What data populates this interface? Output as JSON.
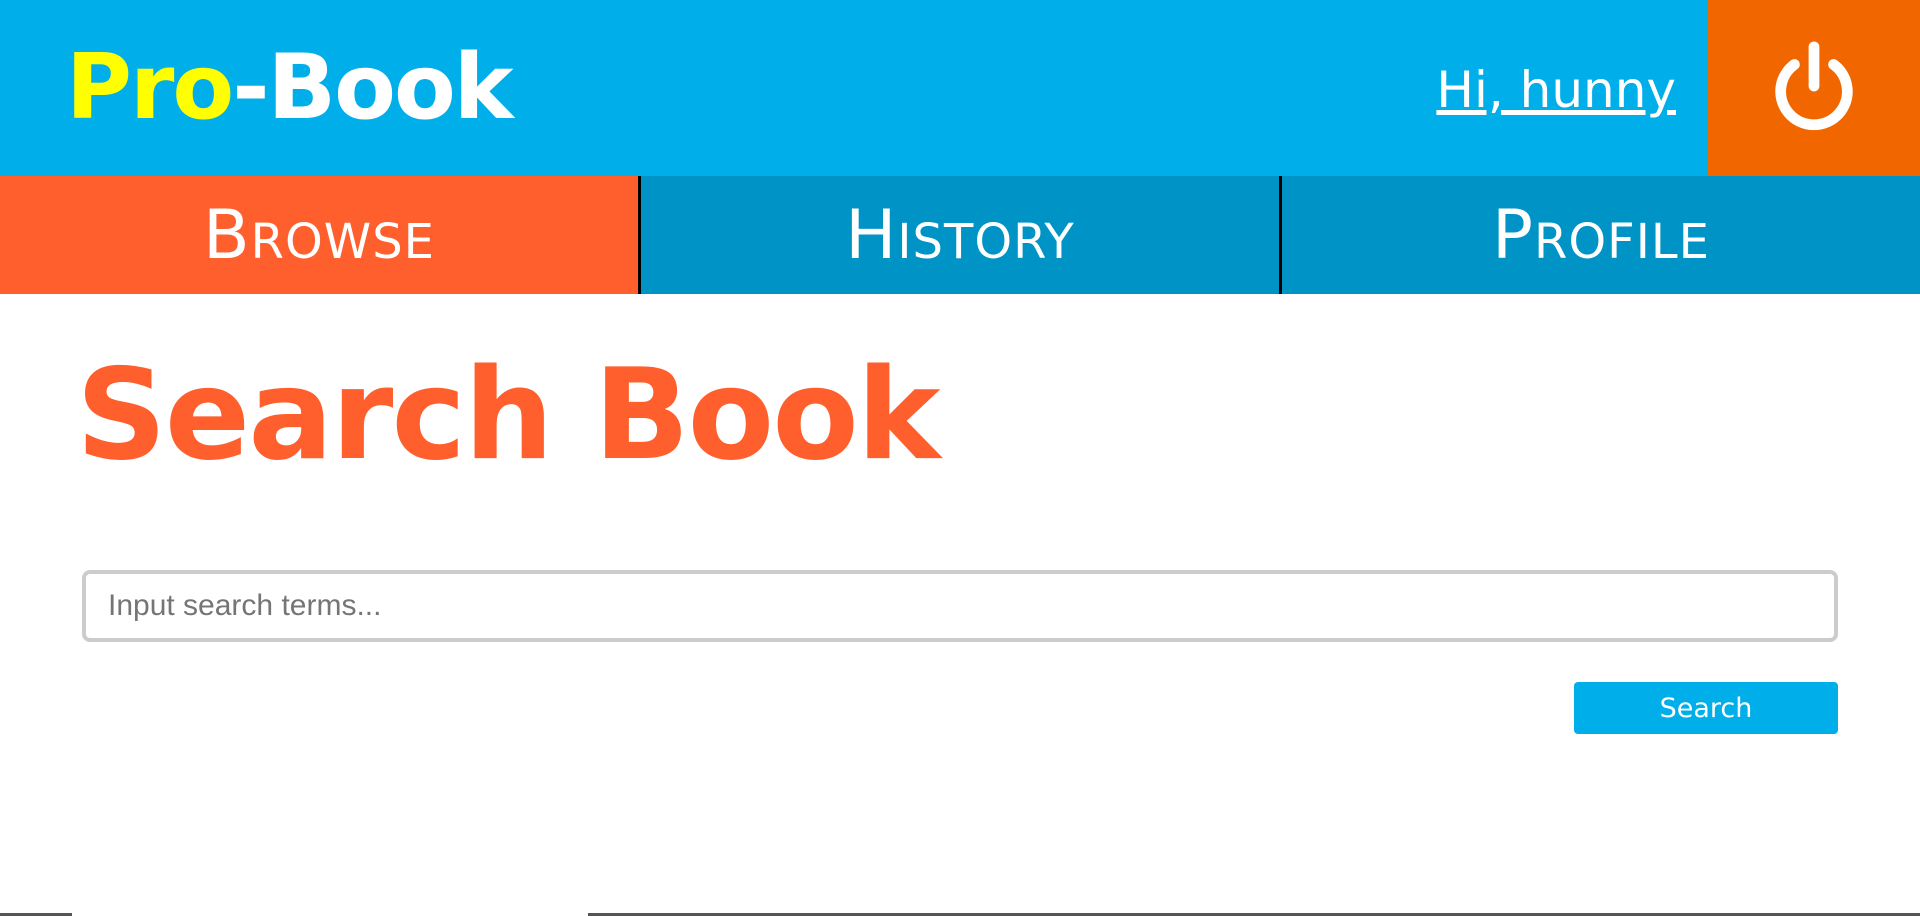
{
  "header": {
    "logo_pro": "Pro",
    "logo_rest": "-Book",
    "greeting": "Hi, hunny",
    "logout_icon": "power-icon"
  },
  "nav": {
    "tabs": [
      {
        "label": "Browse",
        "active": true
      },
      {
        "label": "History",
        "active": false
      },
      {
        "label": "Profile",
        "active": false
      }
    ]
  },
  "main": {
    "title": "Search Book",
    "search_placeholder": "Input search terms...",
    "search_value": "",
    "search_button": "Search"
  },
  "colors": {
    "header_bg": "#00aee9",
    "logo_accent": "#ffff00",
    "logout_bg": "#f26600",
    "tab_active": "#ff5f2c",
    "tab_inactive": "#0094c6",
    "title": "#ff5f2c",
    "button": "#00aee9"
  }
}
